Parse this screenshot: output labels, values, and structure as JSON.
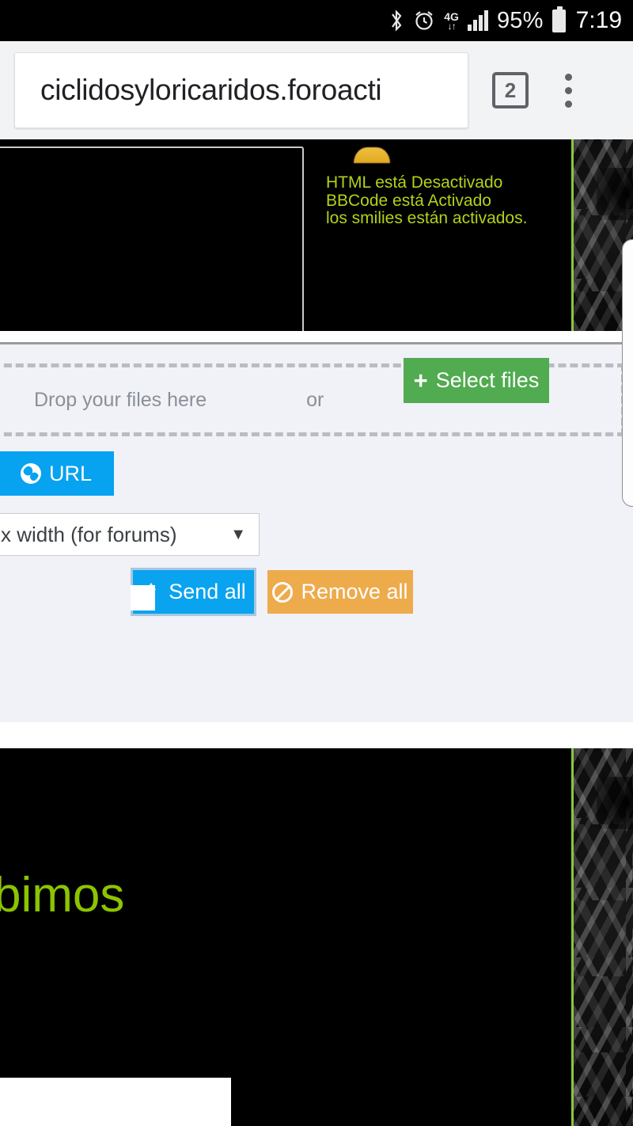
{
  "status_bar": {
    "bluetooth_icon": "bluetooth-icon",
    "alarm_icon": "alarm-clock-icon",
    "network_label": "4G",
    "network_arrows": "↓↑",
    "signal_icon": "signal-bars-icon",
    "battery_percent": "95%",
    "battery_icon": "battery-full-icon",
    "time": "7:19"
  },
  "browser": {
    "url": "ciclidosyloricaridos.foroacti",
    "tab_count": "2",
    "menu_icon": "overflow-menu-icon"
  },
  "forum_top": {
    "note_line_1": "HTML está Desactivado",
    "note_line_2": "BBCode está Activado",
    "note_line_3": "los smilies están activados.",
    "accent_color": "#b4d11a",
    "border_color": "#8cc63e"
  },
  "upload_panel": {
    "background_color": "#f0f2f7",
    "dropzone": {
      "prompt": "Drop your files here",
      "or_label": "or",
      "select_files_label": "Select files",
      "select_files_icon": "plus-icon",
      "select_files_color": "#51ab50"
    },
    "url_button": {
      "label": "URL",
      "icon": "globe-icon",
      "color": "#07a2f0"
    },
    "size_select": {
      "value": "x width (for forums)",
      "caret_icon": "chevron-down-icon"
    },
    "send_all": {
      "label": "Send all",
      "icon": "upload-icon",
      "color": "#09a3f0"
    },
    "remove_all": {
      "label": "Remove all",
      "icon": "ban-icon",
      "color": "#eeab4c"
    }
  },
  "forum_bottom": {
    "headline": "bimos",
    "headline_color": "#8cc400"
  }
}
